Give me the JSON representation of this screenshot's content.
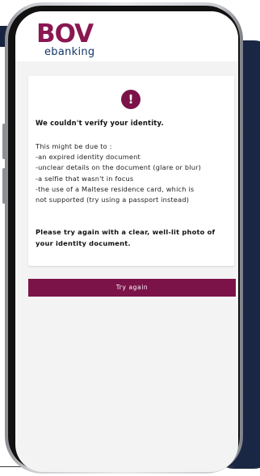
{
  "brand": {
    "logo": "BOV",
    "product": "ebanking",
    "primary_color": "#7b1348",
    "secondary_color": "#123767"
  },
  "alert": {
    "icon": "exclamation-icon",
    "glyph": "!",
    "title": "We couldn't verify your identity.",
    "intro": "This might be due to :",
    "reasons": [
      "-an expired identity document",
      "-unclear details on the document (glare or blur)",
      "-a selfie that wasn't in focus",
      "-the use of a Maltese residence card, which is",
      "not supported (try using a passport instead)"
    ],
    "advice_line1": "Please try again with a clear, well-lit photo of",
    "advice_line2": "your identity document."
  },
  "actions": {
    "try_again_label": "Try again"
  }
}
